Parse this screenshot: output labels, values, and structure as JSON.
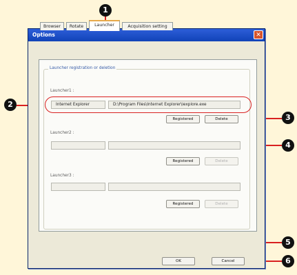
{
  "window": {
    "title": "Options",
    "close_icon": "close-icon"
  },
  "tabs": [
    {
      "label": "Browser"
    },
    {
      "label": "Rotate"
    },
    {
      "label": "Launcher",
      "active": true
    },
    {
      "label": "Acquisition setting"
    }
  ],
  "group": {
    "title": "Launcher registration or deletion"
  },
  "launchers": [
    {
      "label": "Launcher1 :",
      "name": "Internet Explorer",
      "path": "D:\\Program Files\\Internet Explorer\\iexplore.exe",
      "registered_label": "Registered",
      "delete_label": "Delete"
    },
    {
      "label": "Launcher2 :",
      "name": "",
      "path": "",
      "registered_label": "Registered",
      "delete_label": "Delete"
    },
    {
      "label": "Launcher3 :",
      "name": "",
      "path": "",
      "registered_label": "Registered",
      "delete_label": "Delete"
    }
  ],
  "footer": {
    "ok_label": "OK",
    "cancel_label": "Cancel"
  },
  "callouts": [
    "1",
    "2",
    "3",
    "4",
    "5",
    "6"
  ],
  "colors": {
    "background": "#fff6d9",
    "callout_line": "#d92020",
    "titlebar": "#1f52c9"
  }
}
